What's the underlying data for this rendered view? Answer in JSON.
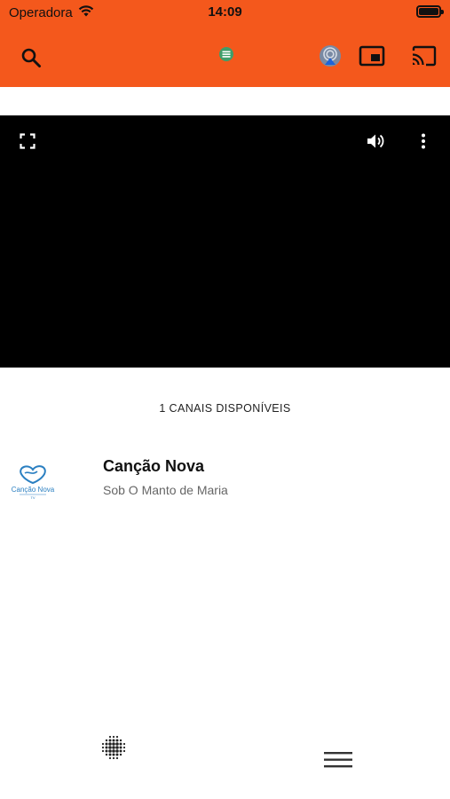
{
  "status_bar": {
    "carrier": "Operadora",
    "time": "14:09"
  },
  "toolbar": {
    "icons": [
      "search-icon",
      "chat-icon",
      "airplay-icon",
      "picture-in-picture-icon",
      "cast-icon"
    ]
  },
  "player": {
    "icons": [
      "fullscreen-icon",
      "volume-icon",
      "more-vertical-icon"
    ]
  },
  "channels": {
    "count_label": "1 CANAIS DISPONÍVEIS",
    "items": [
      {
        "name": "Canção Nova",
        "program": "Sob O Manto de Maria",
        "logo_text": "Canção Nova",
        "logo_subtext": "TV"
      }
    ]
  },
  "bottom_nav": {
    "icons": [
      "dots-grid-icon",
      "menu-icon"
    ]
  },
  "colors": {
    "accent": "#f4581c",
    "video_bg": "#000000",
    "logo_blue": "#2a7fc1"
  }
}
